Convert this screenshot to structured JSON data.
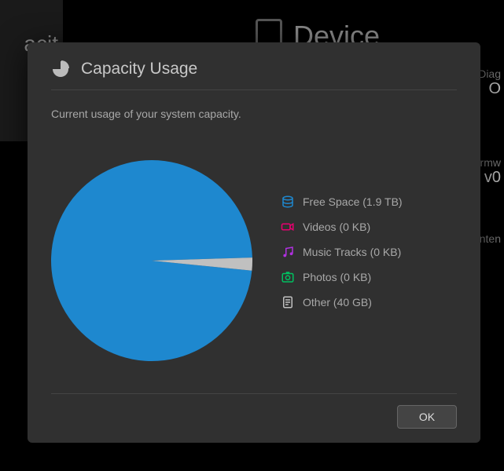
{
  "background": {
    "left_fragment": "acit",
    "device_label": "Device",
    "diag_label": "Diag",
    "diag_value": "O",
    "firmware_label": "Firmw",
    "firmware_value": "v0",
    "content_label": "nten"
  },
  "dialog": {
    "title": "Capacity Usage",
    "subtitle": "Current usage of your system capacity.",
    "ok_label": "OK"
  },
  "legend": [
    {
      "label": "Free Space (1.9 TB)",
      "icon": "disk-icon",
      "color": "#1e88cf"
    },
    {
      "label": "Videos (0 KB)",
      "icon": "camera-icon",
      "color": "#e6006f"
    },
    {
      "label": "Music Tracks (0 KB)",
      "icon": "music-icon",
      "color": "#b030e0"
    },
    {
      "label": "Photos (0 KB)",
      "icon": "photo-icon",
      "color": "#00c060"
    },
    {
      "label": "Other (40 GB)",
      "icon": "document-icon",
      "color": "#c0c0c0"
    }
  ],
  "chart_data": {
    "type": "pie",
    "title": "Capacity Usage",
    "series": [
      {
        "name": "Free Space",
        "value": 1900,
        "unit": "GB",
        "color": "#1e88cf"
      },
      {
        "name": "Videos",
        "value": 0,
        "unit": "GB",
        "color": "#e6006f"
      },
      {
        "name": "Music Tracks",
        "value": 0,
        "unit": "GB",
        "color": "#b030e0"
      },
      {
        "name": "Photos",
        "value": 0,
        "unit": "GB",
        "color": "#00c060"
      },
      {
        "name": "Other",
        "value": 40,
        "unit": "GB",
        "color": "#c0c0c0"
      }
    ]
  }
}
